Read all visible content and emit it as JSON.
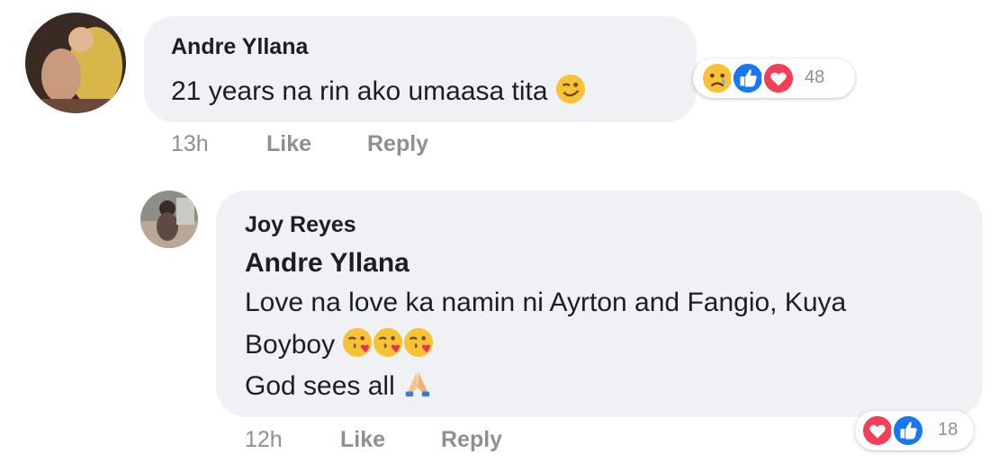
{
  "comment": {
    "author": "Andre Yllana",
    "text": "21 years na rin ako umaasa tita",
    "time": "13h",
    "like_label": "Like",
    "reply_label": "Reply",
    "reaction_count": "48",
    "reactions": [
      "sad-reaction-icon",
      "like-reaction-icon",
      "love-reaction-icon"
    ]
  },
  "reply": {
    "author": "Joy Reyes",
    "mention": "Andre Yllana",
    "line1": "Love na love ka namin ni Ayrton and Fangio, Kuya",
    "line2": "Boyboy",
    "line3": "God sees all",
    "time": "12h",
    "like_label": "Like",
    "reply_label": "Reply",
    "reaction_count": "18",
    "reactions": [
      "love-reaction-icon",
      "like-reaction-icon"
    ]
  },
  "colors": {
    "bubble": "#eff1f4",
    "like_blue": "#1877f2",
    "love_red": "#f33e58",
    "meta_gray": "#8c8f94"
  }
}
